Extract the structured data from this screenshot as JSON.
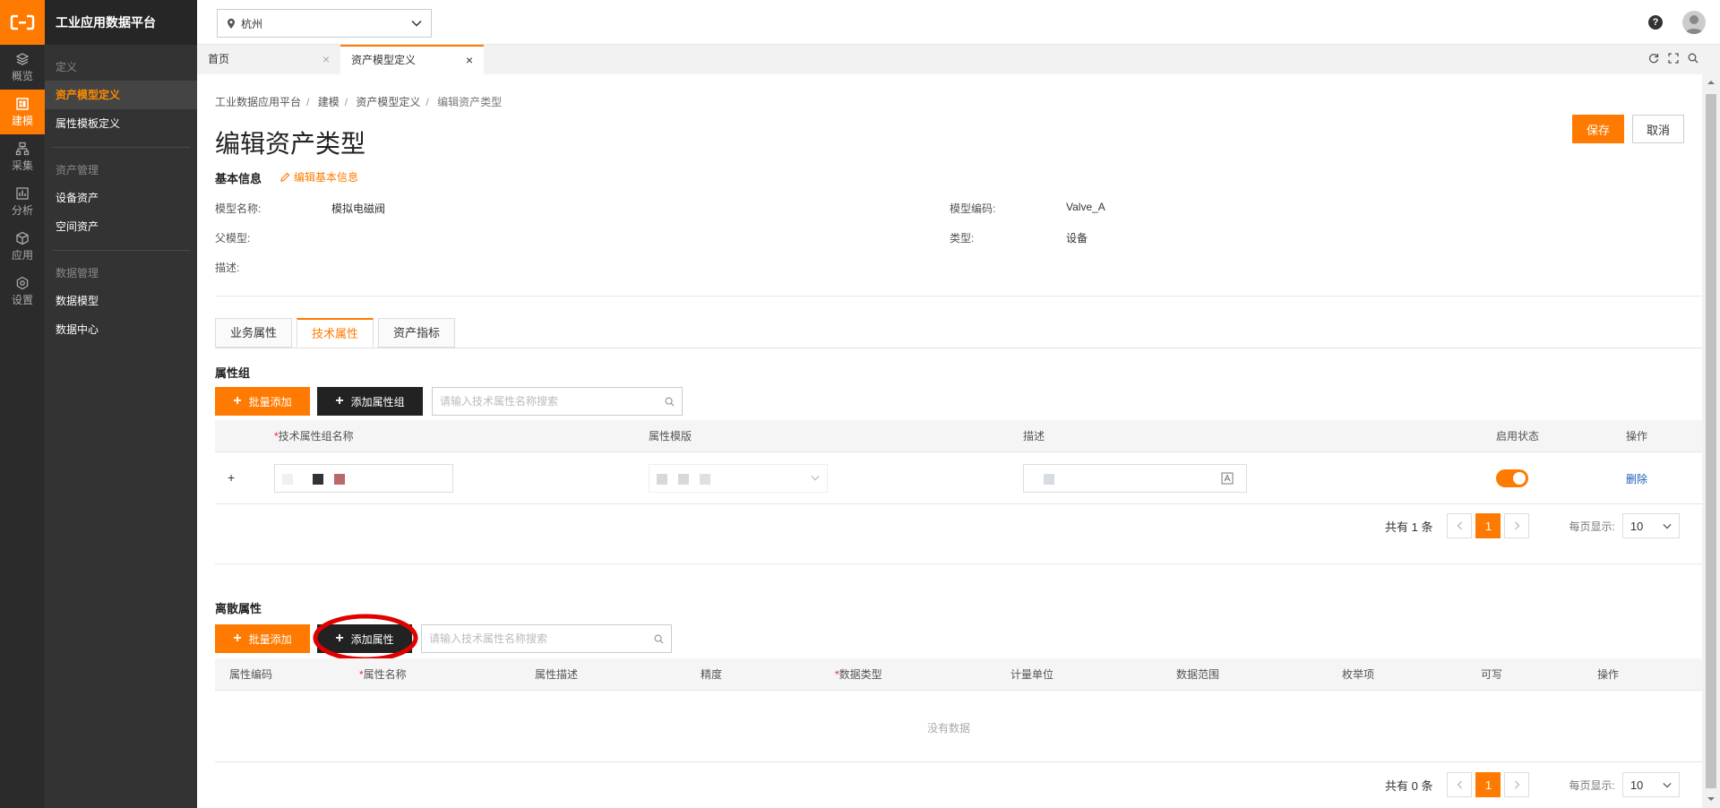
{
  "app": {
    "title": "工业应用数据平台",
    "rail": [
      {
        "label": "概览",
        "icon": "layers-icon"
      },
      {
        "label": "建模",
        "icon": "model-icon"
      },
      {
        "label": "采集",
        "icon": "collect-icon"
      },
      {
        "label": "分析",
        "icon": "chart-icon"
      },
      {
        "label": "应用",
        "icon": "cube-icon"
      },
      {
        "label": "设置",
        "icon": "settings-icon"
      }
    ],
    "submenu": {
      "groups": [
        "定义",
        "资产管理",
        "数据管理"
      ],
      "items": [
        "资产模型定义",
        "属性模板定义",
        "设备资产",
        "空间资产",
        "数据模型",
        "数据中心"
      ]
    }
  },
  "topbar": {
    "city": "杭州",
    "help": "?"
  },
  "tabs": [
    {
      "label": "首页"
    },
    {
      "label": "资产模型定义"
    }
  ],
  "breadcrumb": [
    "工业数据应用平台",
    "建模",
    "资产模型定义",
    "编辑资产类型"
  ],
  "page": {
    "title": "编辑资产类型",
    "save": "保存",
    "cancel": "取消"
  },
  "basic": {
    "title": "基本信息",
    "edit": "编辑基本信息",
    "model_name_label": "模型名称:",
    "model_name": "模拟电磁阀",
    "model_code_label": "模型编码:",
    "model_code": "Valve_A",
    "parent_label": "父模型:",
    "type_label": "类型:",
    "type": "设备",
    "desc_label": "描述:"
  },
  "attr_tabs": [
    "业务属性",
    "技术属性",
    "资产指标"
  ],
  "group_section": {
    "title": "属性组",
    "batch_add": "批量添加",
    "add_group": "添加属性组",
    "search_placeholder": "请输入技术属性名称搜索",
    "columns": [
      "技术属性组名称",
      "属性模版",
      "描述",
      "启用状态",
      "操作"
    ],
    "row_expand": "+",
    "row_delete": "删除",
    "total": "共有 1 条",
    "page": "1",
    "page_size_label": "每页显示:",
    "page_size": "10"
  },
  "discrete_section": {
    "title": "离散属性",
    "batch_add": "批量添加",
    "add_attr": "添加属性",
    "search_placeholder": "请输入技术属性名称搜索",
    "columns": [
      "属性编码",
      "属性名称",
      "属性描述",
      "精度",
      "数据类型",
      "计量单位",
      "数据范围",
      "枚举项",
      "可写",
      "操作"
    ],
    "empty": "没有数据",
    "total": "共有 0 条",
    "page": "1",
    "page_size_label": "每页显示:",
    "page_size": "10"
  },
  "colors": {
    "accent": "#ff7a00",
    "dark": "#222222",
    "highlight": "#e00000"
  }
}
